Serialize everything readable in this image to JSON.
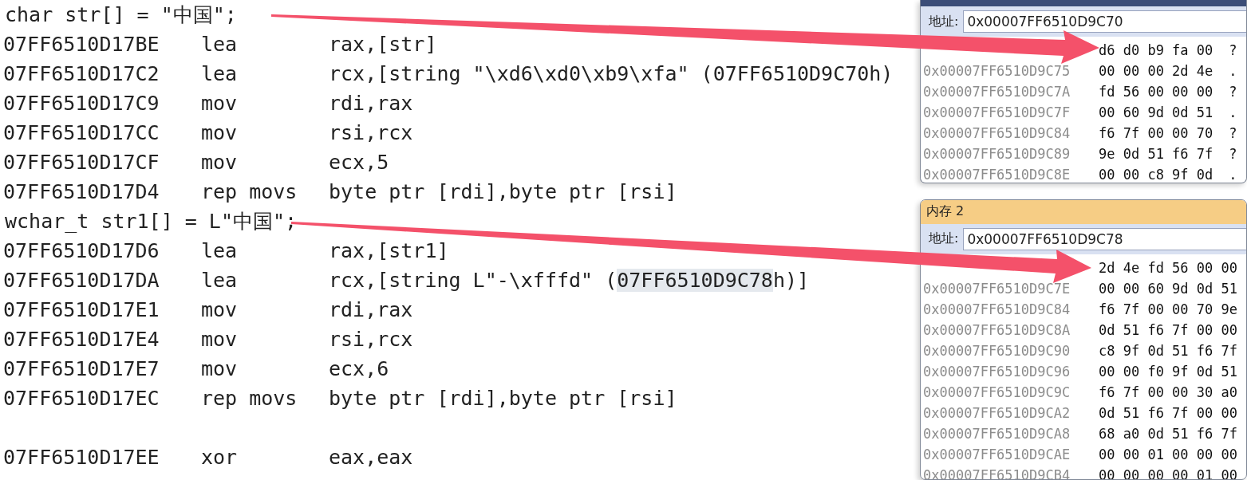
{
  "disassembly": {
    "lines": [
      {
        "kind": "source",
        "text": "char str[] = \"中国\";"
      },
      {
        "kind": "asm",
        "address": "07FF6510D17BE",
        "mnemonic": "lea",
        "operand": [
          {
            "text": "rax,[str]",
            "highlighted": false
          }
        ]
      },
      {
        "kind": "asm",
        "address": "07FF6510D17C2",
        "mnemonic": "lea",
        "operand": [
          {
            "text": "rcx,[string \"\\xd6\\xd0\\xb9\\xfa\" (07FF6510D9C70h)",
            "highlighted": false
          }
        ]
      },
      {
        "kind": "asm",
        "address": "07FF6510D17C9",
        "mnemonic": "mov",
        "operand": [
          {
            "text": "rdi,rax",
            "highlighted": false
          }
        ]
      },
      {
        "kind": "asm",
        "address": "07FF6510D17CC",
        "mnemonic": "mov",
        "operand": [
          {
            "text": "rsi,rcx",
            "highlighted": false
          }
        ]
      },
      {
        "kind": "asm",
        "address": "07FF6510D17CF",
        "mnemonic": "mov",
        "operand": [
          {
            "text": "ecx,5",
            "highlighted": false
          }
        ]
      },
      {
        "kind": "asm",
        "address": "07FF6510D17D4",
        "mnemonic": "rep movs",
        "operand": [
          {
            "text": "byte ptr [rdi],byte ptr [rsi]",
            "highlighted": false
          }
        ]
      },
      {
        "kind": "source",
        "text": "wchar_t str1[] = L\"中国\";"
      },
      {
        "kind": "asm",
        "address": "07FF6510D17D6",
        "mnemonic": "lea",
        "operand": [
          {
            "text": "rax,[str1]",
            "highlighted": false
          }
        ]
      },
      {
        "kind": "asm",
        "address": "07FF6510D17DA",
        "mnemonic": "lea",
        "operand": [
          {
            "text": "rcx,[string L\"-\\xfffd\" (",
            "highlighted": false
          },
          {
            "text": "07FF6510D9C78",
            "highlighted": true
          },
          {
            "text": "h)]",
            "highlighted": false
          }
        ]
      },
      {
        "kind": "asm",
        "address": "07FF6510D17E1",
        "mnemonic": "mov",
        "operand": [
          {
            "text": "rdi,rax",
            "highlighted": false
          }
        ]
      },
      {
        "kind": "asm",
        "address": "07FF6510D17E4",
        "mnemonic": "mov",
        "operand": [
          {
            "text": "rsi,rcx",
            "highlighted": false
          }
        ]
      },
      {
        "kind": "asm",
        "address": "07FF6510D17E7",
        "mnemonic": "mov",
        "operand": [
          {
            "text": "ecx,6",
            "highlighted": false
          }
        ]
      },
      {
        "kind": "asm",
        "address": "07FF6510D17EC",
        "mnemonic": "rep movs",
        "operand": [
          {
            "text": "byte ptr [rdi],byte ptr [rsi]",
            "highlighted": false
          }
        ]
      },
      {
        "kind": "blank"
      },
      {
        "kind": "asm",
        "address": "07FF6510D17EE",
        "mnemonic": "xor",
        "operand": [
          {
            "text": "eax,eax",
            "highlighted": false
          }
        ]
      }
    ]
  },
  "memory_windows": [
    {
      "kind": "blue",
      "address_label": "地址:",
      "address": "0x00007FF6510D9C70",
      "rows": [
        {
          "bytes": "d6 d0 b9 fa 00",
          "ascii": "?"
        },
        {
          "address": "0x00007FF6510D9C75",
          "bytes": "00 00 00 2d 4e",
          "ascii": "."
        },
        {
          "address": "0x00007FF6510D9C7A",
          "bytes": "fd 56 00 00 00",
          "ascii": "?"
        },
        {
          "address": "0x00007FF6510D9C7F",
          "bytes": "00 60 9d 0d 51",
          "ascii": "."
        },
        {
          "address": "0x00007FF6510D9C84",
          "bytes": "f6 7f 00 00 70",
          "ascii": "?"
        },
        {
          "address": "0x00007FF6510D9C89",
          "bytes": "9e 0d 51 f6 7f",
          "ascii": "?"
        },
        {
          "address": "0x00007FF6510D9C8E",
          "bytes": "00 00 c8 9f 0d",
          "ascii": "."
        }
      ]
    },
    {
      "kind": "yellow",
      "title": "内存 2",
      "address_label": "地址:",
      "address": "0x00007FF6510D9C78",
      "rows": [
        {
          "bytes": "2d 4e fd 56 00 00"
        },
        {
          "address": "0x00007FF6510D9C7E",
          "bytes": "00 00 60 9d 0d 51"
        },
        {
          "address": "0x00007FF6510D9C84",
          "bytes": "f6 7f 00 00 70 9e"
        },
        {
          "address": "0x00007FF6510D9C8A",
          "bytes": "0d 51 f6 7f 00 00"
        },
        {
          "address": "0x00007FF6510D9C90",
          "bytes": "c8 9f 0d 51 f6 7f"
        },
        {
          "address": "0x00007FF6510D9C96",
          "bytes": "00 00 f0 9f 0d 51"
        },
        {
          "address": "0x00007FF6510D9C9C",
          "bytes": "f6 7f 00 00 30 a0"
        },
        {
          "address": "0x00007FF6510D9CA2",
          "bytes": "0d 51 f6 7f 00 00"
        },
        {
          "address": "0x00007FF6510D9CA8",
          "bytes": "68 a0 0d 51 f6 7f"
        },
        {
          "address": "0x00007FF6510D9CAE",
          "bytes": "00 00 01 00 00 00"
        },
        {
          "address": "0x00007FF6510D9CB4",
          "bytes": "00 00 00 00 01 00"
        }
      ]
    }
  ]
}
